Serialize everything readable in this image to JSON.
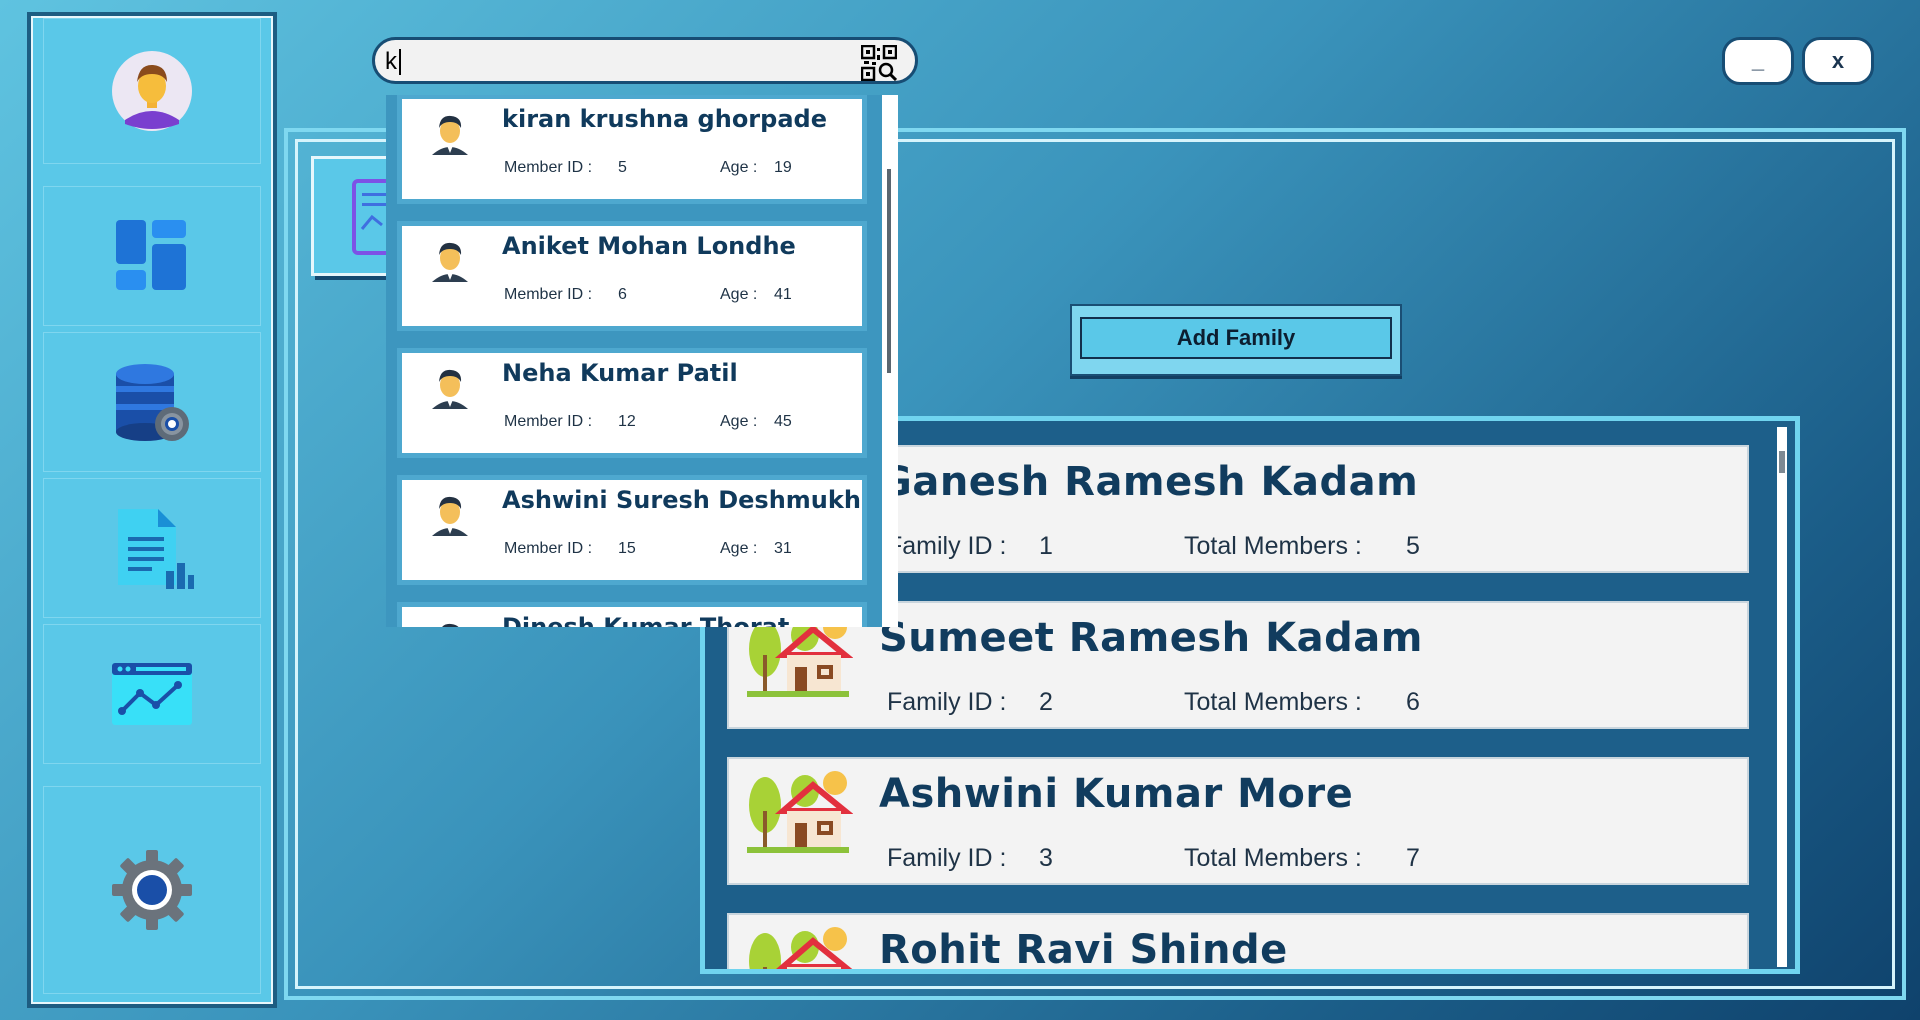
{
  "search": {
    "value": "k"
  },
  "window": {
    "minimize_label": "_",
    "close_label": "x"
  },
  "sidebar": {
    "items": [
      {
        "name": "profile",
        "icon": "user-avatar-icon"
      },
      {
        "name": "dashboard",
        "icon": "dashboard-icon"
      },
      {
        "name": "database-settings",
        "icon": "database-gear-icon"
      },
      {
        "name": "report",
        "icon": "report-document-icon"
      },
      {
        "name": "analytics",
        "icon": "analytics-chart-icon"
      },
      {
        "name": "settings",
        "icon": "gear-icon"
      }
    ]
  },
  "main": {
    "add_family_label": "Add Family"
  },
  "members": [
    {
      "name": "kiran krushna ghorpade",
      "id_label": "Member ID :",
      "id": "5",
      "age_label": "Age :",
      "age": "19"
    },
    {
      "name": "Aniket Mohan Londhe",
      "id_label": "Member ID :",
      "id": "6",
      "age_label": "Age :",
      "age": "41"
    },
    {
      "name": "Neha Kumar Patil",
      "id_label": "Member ID :",
      "id": "12",
      "age_label": "Age :",
      "age": "45"
    },
    {
      "name": "Ashwini Suresh Deshmukh",
      "id_label": "Member ID :",
      "id": "15",
      "age_label": "Age :",
      "age": "31"
    },
    {
      "name": "Dinesh Kumar Thorat",
      "id_label": "",
      "id": "",
      "age_label": "",
      "age": ""
    }
  ],
  "families": [
    {
      "name": "Ganesh Ramesh Kadam",
      "id_label": "Family ID :",
      "id": "1",
      "members_label": "Total Members :",
      "members": "5"
    },
    {
      "name": "Sumeet Ramesh Kadam",
      "id_label": "Family ID :",
      "id": "2",
      "members_label": "Total Members :",
      "members": "6"
    },
    {
      "name": "Ashwini Kumar More",
      "id_label": "Family ID :",
      "id": "3",
      "members_label": "Total Members :",
      "members": "7"
    },
    {
      "name": "Rohit Ravi Shinde",
      "id_label": "",
      "id": "",
      "members_label": "",
      "members": ""
    }
  ]
}
